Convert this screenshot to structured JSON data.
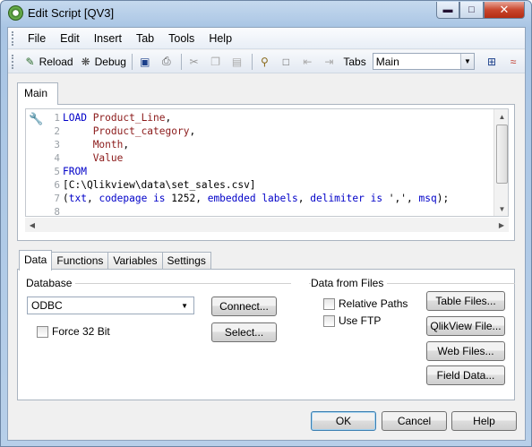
{
  "window": {
    "title": "Edit Script [QV3]"
  },
  "menu": [
    "File",
    "Edit",
    "Insert",
    "Tab",
    "Tools",
    "Help"
  ],
  "toolbar": {
    "reload_label": "Reload",
    "debug_label": "Debug",
    "tabs_label": "Tabs",
    "tab_select_value": "Main"
  },
  "script_tab": "Main",
  "editor": {
    "line_numbers": [
      "1",
      "2",
      "3",
      "4",
      "5",
      "6",
      "7",
      "8"
    ],
    "lines": [
      [
        {
          "c": "kw",
          "t": "LOAD "
        },
        {
          "c": "fld",
          "t": "Product_Line"
        },
        {
          "c": "txt",
          "t": ","
        }
      ],
      [
        {
          "c": "txt",
          "t": "     "
        },
        {
          "c": "fld",
          "t": "Product_category"
        },
        {
          "c": "txt",
          "t": ","
        }
      ],
      [
        {
          "c": "txt",
          "t": "     "
        },
        {
          "c": "fld",
          "t": "Month"
        },
        {
          "c": "txt",
          "t": ","
        }
      ],
      [
        {
          "c": "txt",
          "t": "     "
        },
        {
          "c": "fld",
          "t": "Value"
        }
      ],
      [
        {
          "c": "kw",
          "t": "FROM"
        }
      ],
      [
        {
          "c": "txt",
          "t": "[C:\\Qlikview\\data\\set_sales.csv]"
        }
      ],
      [
        {
          "c": "txt",
          "t": "("
        },
        {
          "c": "kw",
          "t": "txt"
        },
        {
          "c": "txt",
          "t": ", "
        },
        {
          "c": "kw",
          "t": "codepage is"
        },
        {
          "c": "txt",
          "t": " 1252, "
        },
        {
          "c": "kw",
          "t": "embedded labels"
        },
        {
          "c": "txt",
          "t": ", "
        },
        {
          "c": "kw",
          "t": "delimiter is"
        },
        {
          "c": "txt",
          "t": " ',', "
        },
        {
          "c": "kw",
          "t": "msq"
        },
        {
          "c": "txt",
          "t": ");"
        }
      ],
      []
    ]
  },
  "bottom_tabs": [
    "Data",
    "Functions",
    "Variables",
    "Settings"
  ],
  "database": {
    "group_label": "Database",
    "combo_value": "ODBC",
    "connect_button": "Connect...",
    "select_button": "Select...",
    "force32_label": "Force 32 Bit"
  },
  "files": {
    "group_label": "Data from Files",
    "relative_paths_label": "Relative Paths",
    "use_ftp_label": "Use FTP",
    "table_files_button": "Table Files...",
    "qlikview_file_button": "QlikView File...",
    "web_files_button": "Web Files...",
    "field_data_button": "Field Data..."
  },
  "footer": {
    "ok_label": "OK",
    "cancel_label": "Cancel",
    "help_label": "Help"
  }
}
